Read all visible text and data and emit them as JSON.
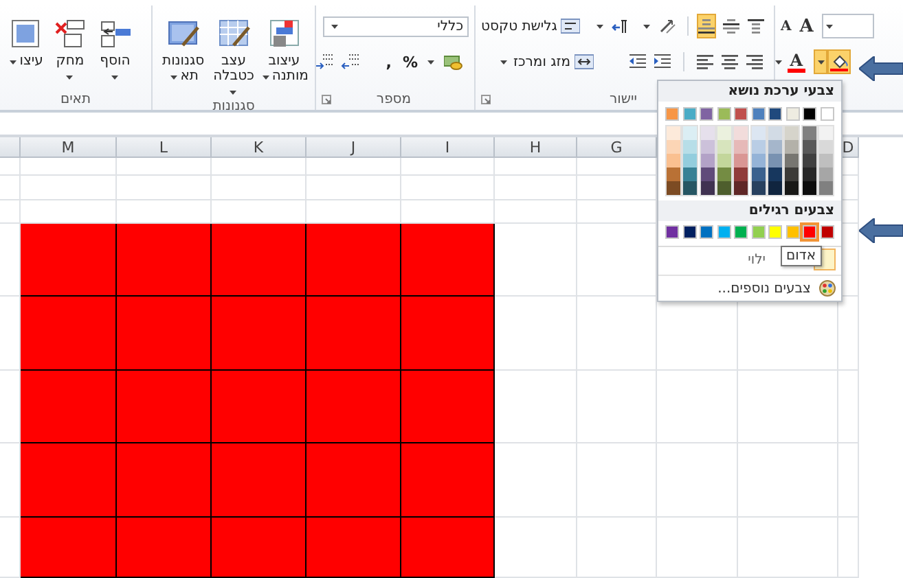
{
  "ribbon": {
    "groups": [
      {
        "kind": "font",
        "size_glyphs": [
          {
            "glyph": "A",
            "kind": "grow"
          },
          {
            "glyph": "A",
            "kind": "shrink"
          }
        ],
        "fill_button": {
          "expanded": true
        },
        "font_color_glyph": "A"
      },
      {
        "kind": "alignment",
        "label": "יישור",
        "wrap_text": "גלישת טקסט",
        "merge_center": "מזג ומרכז",
        "vertical_align": [
          {
            "selected": false
          },
          {
            "selected": false
          },
          {
            "selected": true
          }
        ]
      },
      {
        "kind": "number",
        "label": "מספר",
        "format_field": {
          "value": "כללי"
        },
        "percent": "%",
        "comma": ","
      },
      {
        "kind": "styles",
        "label": "סגנונות",
        "buttons": [
          {
            "label": "עיצוב מותנה",
            "dropdown": true
          },
          {
            "label": "עצב כטבלה",
            "dropdown": true
          },
          {
            "label": "סגנונות תא",
            "dropdown": true
          }
        ]
      },
      {
        "kind": "cells",
        "label": "תאים",
        "buttons": [
          {
            "label": "הוסף",
            "dropdown": true
          },
          {
            "label": "מחק",
            "dropdown": true
          },
          {
            "label": "עיצו",
            "dropdown": true
          }
        ]
      }
    ]
  },
  "sheet": {
    "columns": [
      {
        "label": "D",
        "filled": false
      },
      {
        "label": "G",
        "filled": false
      },
      {
        "label": "H",
        "filled": false
      },
      {
        "label": "I",
        "filled": true
      },
      {
        "label": "J",
        "filled": true
      },
      {
        "label": "K",
        "filled": true
      },
      {
        "label": "L",
        "filled": true
      },
      {
        "label": "M",
        "filled": true
      }
    ],
    "rows": [
      {
        "filled": false
      },
      {
        "filled": false
      },
      {
        "filled": false
      },
      {
        "filled": true
      },
      {
        "filled": true
      },
      {
        "filled": true
      },
      {
        "filled": true
      },
      {
        "filled": true
      }
    ]
  },
  "color_menu": {
    "theme_heading": "צבעי ערכת נושא",
    "theme_colors": [
      {
        "color": "#ffffff",
        "selected": false
      },
      {
        "color": "#000000",
        "selected": false
      },
      {
        "color": "#eeece1",
        "selected": false
      },
      {
        "color": "#1f497d",
        "selected": false
      },
      {
        "color": "#4f81bd",
        "selected": false
      },
      {
        "color": "#c0504d",
        "selected": false
      },
      {
        "color": "#9bbb59",
        "selected": false
      },
      {
        "color": "#8064a2",
        "selected": false
      },
      {
        "color": "#4bacc6",
        "selected": false
      },
      {
        "color": "#f79646",
        "selected": false
      }
    ],
    "standard_heading": "צבעים רגילים",
    "standard_colors": [
      {
        "color": "#c00000",
        "selected": false
      },
      {
        "color": "#ff0000",
        "selected": true
      },
      {
        "color": "#ffc000",
        "selected": false
      },
      {
        "color": "#ffff00",
        "selected": false
      },
      {
        "color": "#92d050",
        "selected": false
      },
      {
        "color": "#00b050",
        "selected": false
      },
      {
        "color": "#00b0f0",
        "selected": false
      },
      {
        "color": "#0070c0",
        "selected": false
      },
      {
        "color": "#002060",
        "selected": false
      },
      {
        "color": "#7030a0",
        "selected": false
      }
    ],
    "no_fill": "ילוי",
    "more_colors": "צבעים נוספים...",
    "tooltip": "אדום"
  }
}
